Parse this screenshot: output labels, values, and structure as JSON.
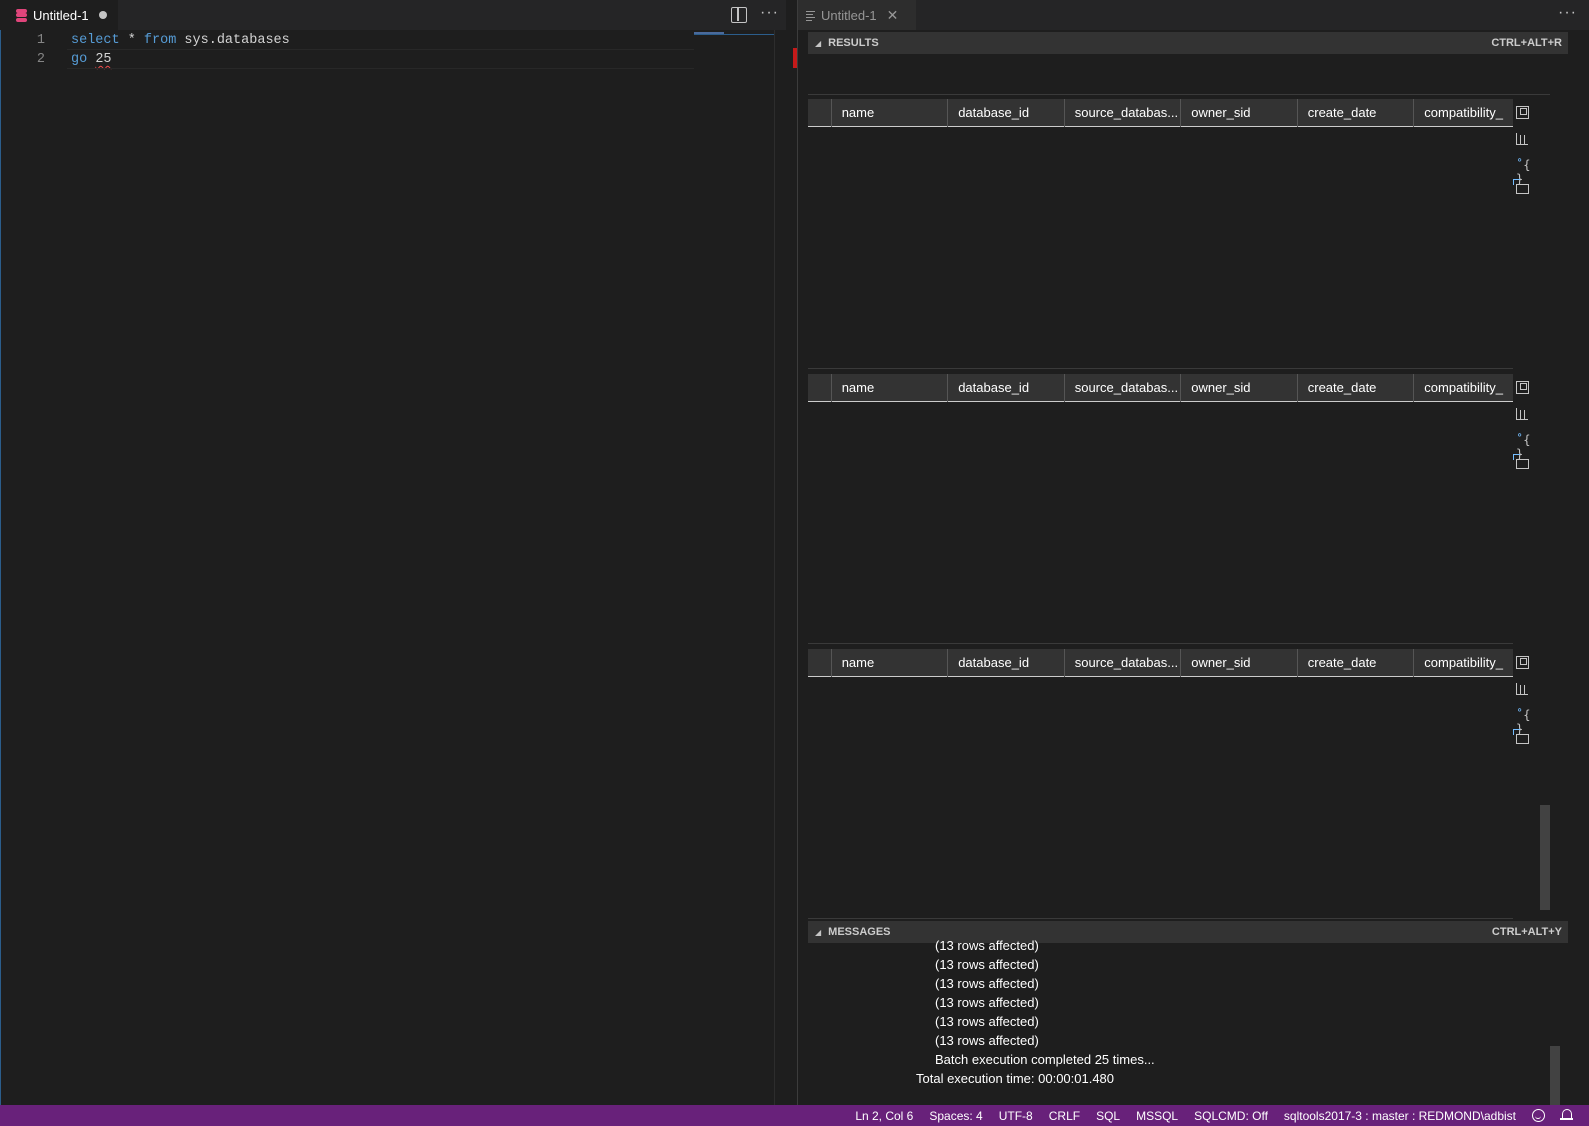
{
  "editor": {
    "tab": {
      "title": "Untitled-1",
      "dirty": true
    },
    "lines": [
      {
        "num": "1",
        "tokens": {
          "kw1": "select",
          "op": " * ",
          "kw2": "from",
          "rest": " sys.databases"
        }
      },
      {
        "num": "2",
        "tokens": {
          "kw1": "go",
          "sp": " ",
          "num": "25"
        }
      }
    ]
  },
  "results_view": {
    "tab": {
      "title": "Untitled-1",
      "close": "✕"
    },
    "results_panel": {
      "title": "RESULTS",
      "shortcut": "CTRL+ALT+R"
    },
    "columns": [
      "name",
      "database_id",
      "source_databas...",
      "owner_sid",
      "create_date",
      "compatibility_"
    ],
    "grids": 3,
    "grid_action_icons": [
      "maximize-icon",
      "save-as-csv-icon",
      "save-as-json-icon",
      "save-as-excel-icon"
    ],
    "messages_panel": {
      "title": "MESSAGES",
      "shortcut": "CTRL+ALT+Y"
    },
    "messages": [
      "(13 rows affected)",
      "(13 rows affected)",
      "(13 rows affected)",
      "(13 rows affected)",
      "(13 rows affected)",
      "(13 rows affected)",
      "Batch execution completed 25 times..."
    ],
    "total_time": "Total execution time: 00:00:01.480"
  },
  "statusbar": {
    "position": "Ln 2, Col 6",
    "spaces": "Spaces: 4",
    "encoding": "UTF-8",
    "eol": "CRLF",
    "language": "SQL",
    "provider": "MSSQL",
    "sqlcmd": "SQLCMD: Off",
    "connection": "sqltools2017-3 : master : REDMOND\\adbist",
    "color": "#68217a"
  },
  "more_actions": "···"
}
